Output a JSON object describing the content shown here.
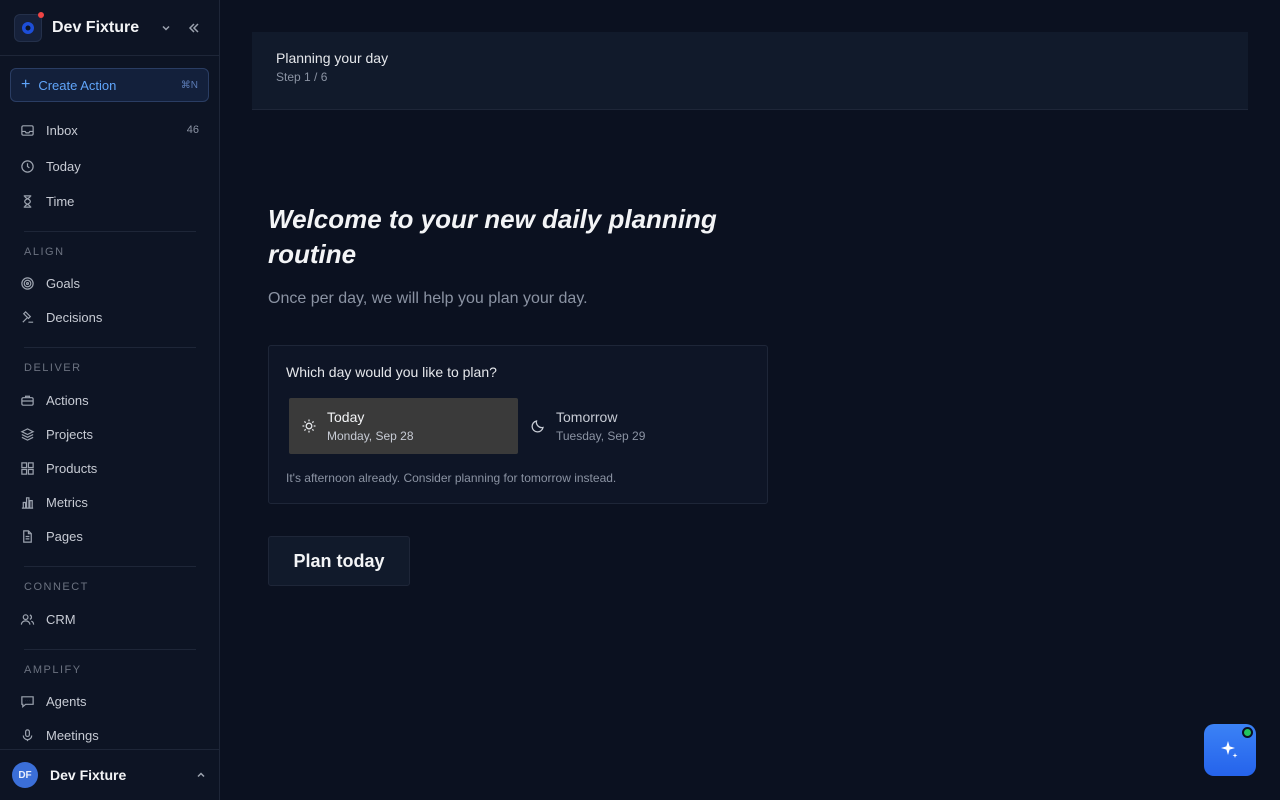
{
  "workspace": {
    "name": "Dev Fixture"
  },
  "create_action": {
    "label": "Create Action",
    "shortcut": "⌘N"
  },
  "nav": {
    "primary": [
      {
        "label": "Inbox",
        "count": "46",
        "icon": "inbox-icon"
      },
      {
        "label": "Today",
        "icon": "clock-icon"
      },
      {
        "label": "Time",
        "icon": "hourglass-icon"
      }
    ],
    "sections": [
      {
        "label": "ALIGN",
        "items": [
          {
            "label": "Goals",
            "icon": "target-icon"
          },
          {
            "label": "Decisions",
            "icon": "gavel-icon"
          }
        ]
      },
      {
        "label": "DELIVER",
        "items": [
          {
            "label": "Actions",
            "icon": "briefcase-icon"
          },
          {
            "label": "Projects",
            "icon": "layers-icon"
          },
          {
            "label": "Products",
            "icon": "grid-icon"
          },
          {
            "label": "Metrics",
            "icon": "bar-chart-icon"
          },
          {
            "label": "Pages",
            "icon": "document-icon"
          }
        ]
      },
      {
        "label": "CONNECT",
        "items": [
          {
            "label": "CRM",
            "icon": "users-icon"
          }
        ]
      },
      {
        "label": "AMPLIFY",
        "items": [
          {
            "label": "Agents",
            "icon": "chat-icon"
          },
          {
            "label": "Meetings",
            "icon": "microphone-icon"
          }
        ]
      }
    ]
  },
  "user": {
    "initials": "DF",
    "name": "Dev Fixture"
  },
  "banner": {
    "title": "Planning your day",
    "step": "Step 1 / 6"
  },
  "main": {
    "headline": "Welcome to your new daily planning routine",
    "subline": "Once per day, we will help you plan your day.",
    "question": "Which day would you like to plan?",
    "options": [
      {
        "title": "Today",
        "date": "Monday, Sep 28",
        "icon": "sun-icon",
        "selected": true
      },
      {
        "title": "Tomorrow",
        "date": "Tuesday, Sep 29",
        "icon": "moon-icon",
        "selected": false
      }
    ],
    "hint": "It's afternoon already. Consider planning for tomorrow instead.",
    "cta": "Plan today"
  },
  "colors": {
    "accent": "#3b82f6",
    "selected_bg": "#3a3a3a",
    "notification_dot": "#ef4444",
    "online": "#22c55e"
  }
}
